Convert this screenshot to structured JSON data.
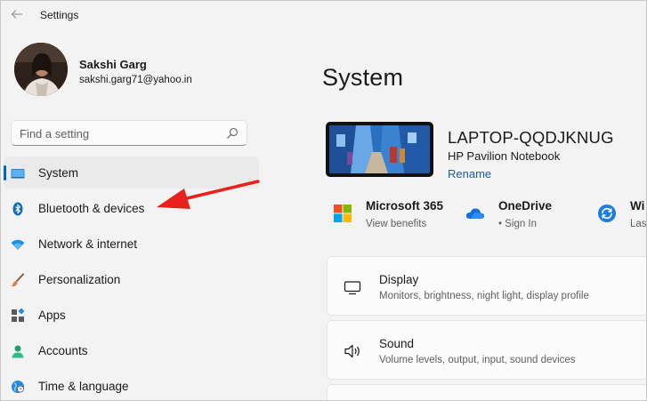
{
  "window": {
    "title": "Settings"
  },
  "profile": {
    "name": "Sakshi Garg",
    "email": "sakshi.garg71@yahoo.in"
  },
  "search": {
    "placeholder": "Find a setting"
  },
  "nav": {
    "items": [
      {
        "label": "System",
        "icon": "system-icon",
        "selected": true
      },
      {
        "label": "Bluetooth & devices",
        "icon": "bluetooth-icon"
      },
      {
        "label": "Network & internet",
        "icon": "wifi-icon"
      },
      {
        "label": "Personalization",
        "icon": "brush-icon"
      },
      {
        "label": "Apps",
        "icon": "apps-icon"
      },
      {
        "label": "Accounts",
        "icon": "person-icon"
      },
      {
        "label": "Time & language",
        "icon": "globe-icon"
      }
    ]
  },
  "main": {
    "title": "System",
    "device": {
      "name": "LAPTOP-QQDJKNUG",
      "model": "HP Pavilion Notebook",
      "rename_label": "Rename"
    },
    "services": [
      {
        "title": "Microsoft 365",
        "subtitle": "View benefits",
        "icon": "microsoft-logo-icon"
      },
      {
        "title": "OneDrive",
        "subtitle": "• Sign In",
        "icon": "onedrive-cloud-icon"
      },
      {
        "title": "Wi",
        "subtitle": "Las",
        "icon": "windows-update-icon"
      }
    ],
    "cards": [
      {
        "title": "Display",
        "subtitle": "Monitors, brightness, night light, display profile",
        "icon": "monitor-icon"
      },
      {
        "title": "Sound",
        "subtitle": "Volume levels, output, input, sound devices",
        "icon": "speaker-icon"
      }
    ]
  },
  "colors": {
    "accent": "#0067c0",
    "annotation": "#e8211c",
    "link": "#1a5ea8"
  }
}
